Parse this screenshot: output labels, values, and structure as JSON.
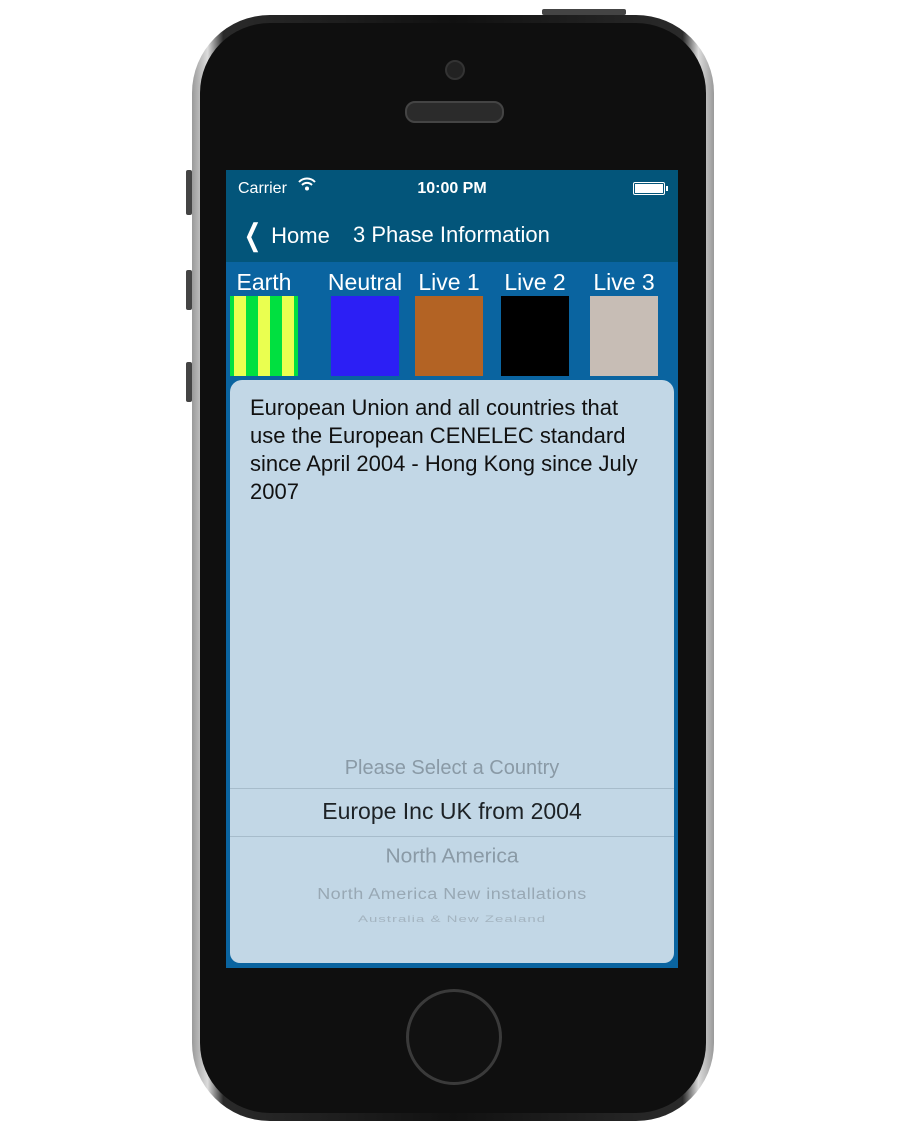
{
  "status_bar": {
    "carrier": "Carrier",
    "time": "10:00 PM"
  },
  "nav": {
    "back_label": "Home",
    "title": "3 Phase Information"
  },
  "wires": [
    {
      "label": "Earth",
      "color": "green-yellow stripes"
    },
    {
      "label": "Neutral",
      "color": "#2c1ff5"
    },
    {
      "label": "Live 1",
      "color": "#b36324"
    },
    {
      "label": "Live 2",
      "color": "#000000"
    },
    {
      "label": "Live 3",
      "color": "#c7bdb5"
    }
  ],
  "description": "European Union and all countries that use the European CENELEC standard since April 2004 - Hong Kong since July 2007",
  "picker": {
    "items": [
      "Please Select a Country",
      "Europe Inc UK from 2004",
      "North America",
      "North America New installations",
      "Australia & New Zealand"
    ],
    "selected": "Europe Inc UK from 2004"
  }
}
